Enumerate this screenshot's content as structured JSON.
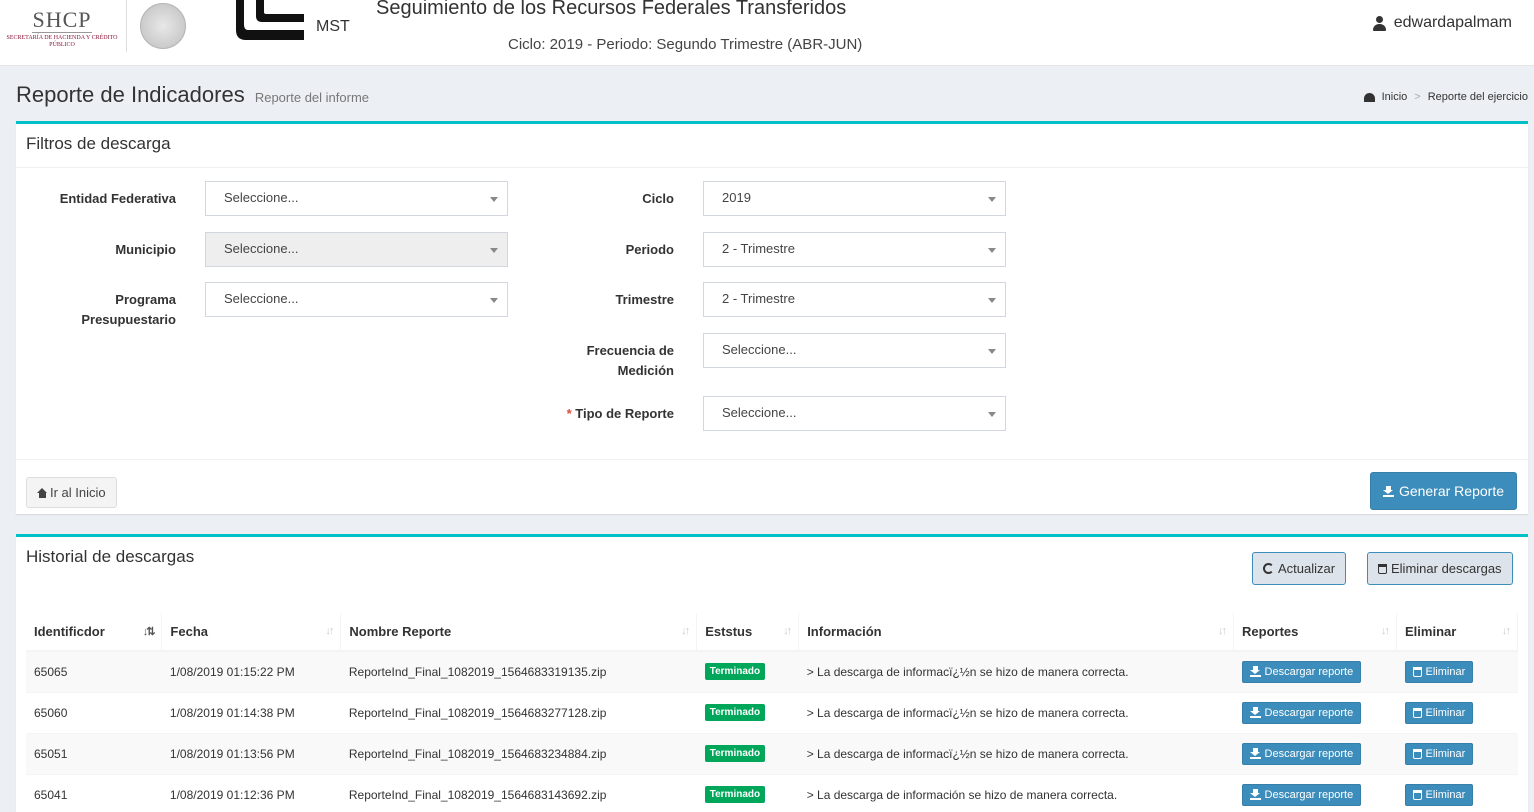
{
  "header": {
    "shcp_logo": "SHCP",
    "shcp_sub": "SECRETARÍA DE HACIENDA Y CRÉDITO PÚBLICO",
    "mst_label": "MST",
    "app_title": "Seguimiento de los Recursos Federales Transferidos",
    "app_subtitle": "Ciclo: 2019 - Periodo: Segundo Trimestre (ABR-JUN)",
    "username": "edwardapalmam"
  },
  "page": {
    "title": "Reporte de Indicadores",
    "subtitle": "Reporte del informe",
    "breadcrumb": [
      "Inicio",
      "Reporte del ejercicio"
    ]
  },
  "filters": {
    "title": "Filtros de descarga",
    "entidad_label": "Entidad Federativa",
    "entidad_value": "Seleccione...",
    "municipio_label": "Municipio",
    "municipio_value": "Seleccione...",
    "programa_label": "Programa Presupuestario",
    "programa_value": "Seleccione...",
    "ciclo_label": "Ciclo",
    "ciclo_value": "2019",
    "periodo_label": "Periodo",
    "periodo_value": "2 - Trimestre",
    "trimestre_label": "Trimestre",
    "trimestre_value": "2 - Trimestre",
    "frecuencia_label": "Frecuencia de Medición",
    "frecuencia_value": "Seleccione...",
    "tipo_required": "*",
    "tipo_label": "Tipo de Reporte",
    "tipo_value": "Seleccione...",
    "home_button": "Ir al Inicio",
    "generate_button": "Generar Reporte"
  },
  "history": {
    "title": "Historial de descargas",
    "refresh_button": "Actualizar",
    "delete_all_button": "Eliminar descargas",
    "columns": [
      "Identificdor",
      "Fecha",
      "Nombre Reporte",
      "Eststus",
      "Información",
      "Reportes",
      "Eliminar"
    ],
    "download_label": "Descargar reporte",
    "delete_label": "Eliminar",
    "rows": [
      {
        "id": "65065",
        "fecha": "1/08/2019 01:15:22 PM",
        "nombre": "ReporteInd_Final_1082019_1564683319135.zip",
        "estatus": "Terminado",
        "info": "> La descarga de informacï¿½n se hizo de manera correcta."
      },
      {
        "id": "65060",
        "fecha": "1/08/2019 01:14:38 PM",
        "nombre": "ReporteInd_Final_1082019_1564683277128.zip",
        "estatus": "Terminado",
        "info": "> La descarga de informacï¿½n se hizo de manera correcta."
      },
      {
        "id": "65051",
        "fecha": "1/08/2019 01:13:56 PM",
        "nombre": "ReporteInd_Final_1082019_1564683234884.zip",
        "estatus": "Terminado",
        "info": "> La descarga de informacï¿½n se hizo de manera correcta."
      },
      {
        "id": "65041",
        "fecha": "1/08/2019 01:12:36 PM",
        "nombre": "ReporteInd_Final_1082019_1564683143692.zip",
        "estatus": "Terminado",
        "info": "> La descarga de información se hizo de manera correcta."
      }
    ]
  },
  "colors": {
    "accent": "#00c0c7",
    "primary": "#3c8dbc",
    "success": "#00a65a"
  }
}
